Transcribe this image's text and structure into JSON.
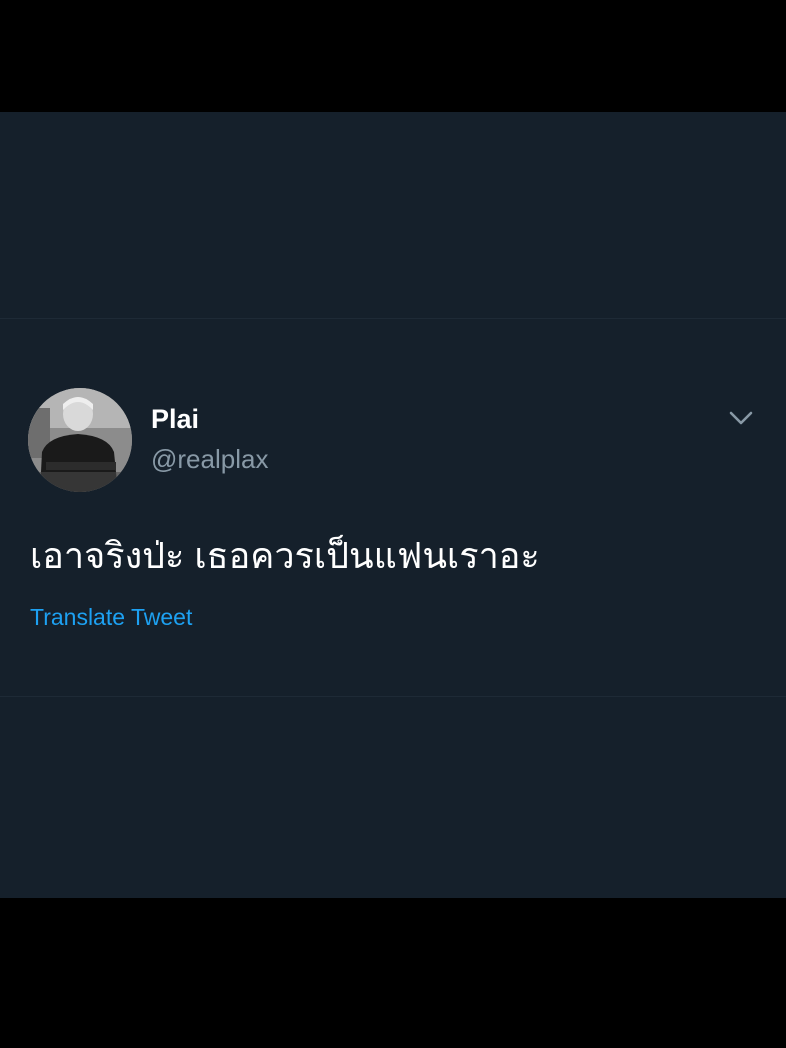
{
  "tweet": {
    "author": {
      "display_name": "Plai",
      "handle": "@realplax",
      "avatar_icon": "profile-photo"
    },
    "text": "เอาจริงป่ะ เธอควรเป็นแฟนเราอะ",
    "translate_label": "Translate Tweet",
    "menu_icon": "chevron-down-icon"
  },
  "colors": {
    "background": "#15202b",
    "letterbox": "#000000",
    "name": "#ffffff",
    "handle": "#8899a6",
    "link": "#1da1f2"
  }
}
